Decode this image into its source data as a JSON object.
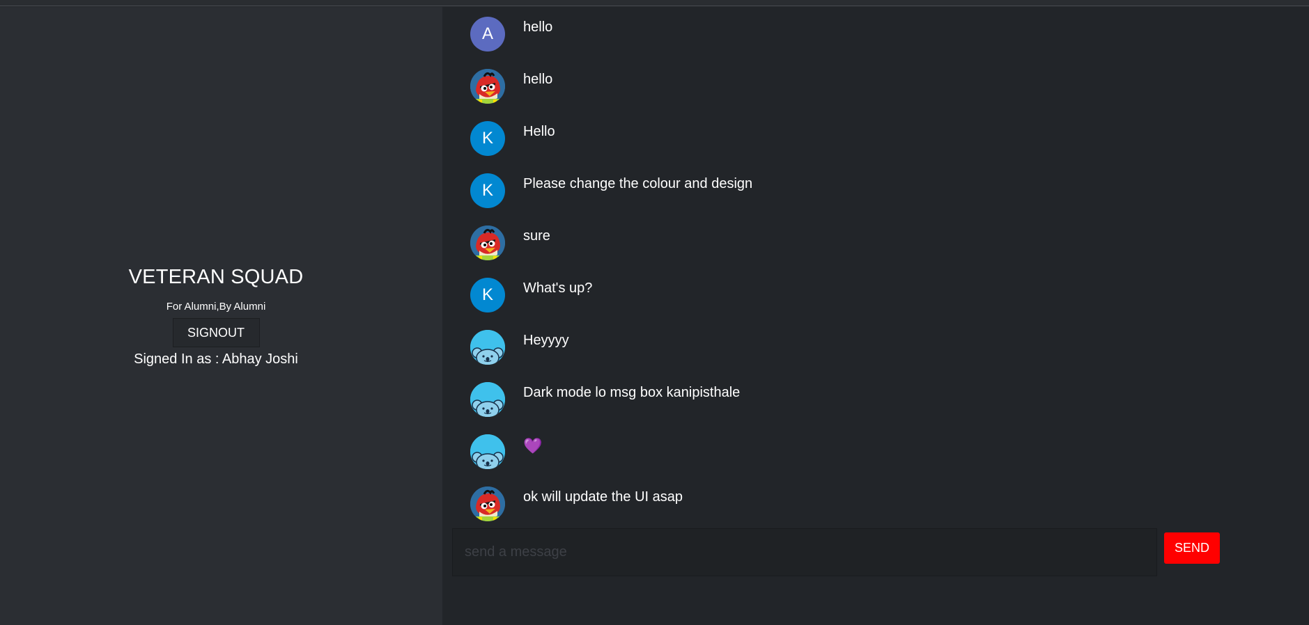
{
  "sidebar": {
    "title": "VETERAN SQUAD",
    "subtitle": "For Alumni,By Alumni",
    "signout_label": "SIGNOUT",
    "signed_in_text": "Signed In as : Abhay Joshi"
  },
  "messages": [
    {
      "avatar": "letter",
      "avatar_letter": "A",
      "avatar_color": "#5c6bc0",
      "text": "hello"
    },
    {
      "avatar": "angry-bird-icon",
      "text": "hello"
    },
    {
      "avatar": "letter",
      "avatar_letter": "K",
      "avatar_color": "#0288d1",
      "text": "Hello"
    },
    {
      "avatar": "letter",
      "avatar_letter": "K",
      "avatar_color": "#0288d1",
      "text": "Please change the colour and design"
    },
    {
      "avatar": "angry-bird-icon",
      "text": "sure"
    },
    {
      "avatar": "letter",
      "avatar_letter": "K",
      "avatar_color": "#0288d1",
      "text": "What's up?"
    },
    {
      "avatar": "koala-icon",
      "text": "Heyyyy"
    },
    {
      "avatar": "koala-icon",
      "text": "Dark mode lo msg box kanipisthale"
    },
    {
      "avatar": "koala-icon",
      "text": "💜"
    },
    {
      "avatar": "angry-bird-icon",
      "text": "ok will update the UI asap"
    }
  ],
  "composer": {
    "placeholder": "send a message",
    "value": "",
    "send_label": "SEND"
  },
  "colors": {
    "send_button": "#ff0000",
    "sidebar_bg": "#2b2e33",
    "chat_bg": "#222529"
  }
}
